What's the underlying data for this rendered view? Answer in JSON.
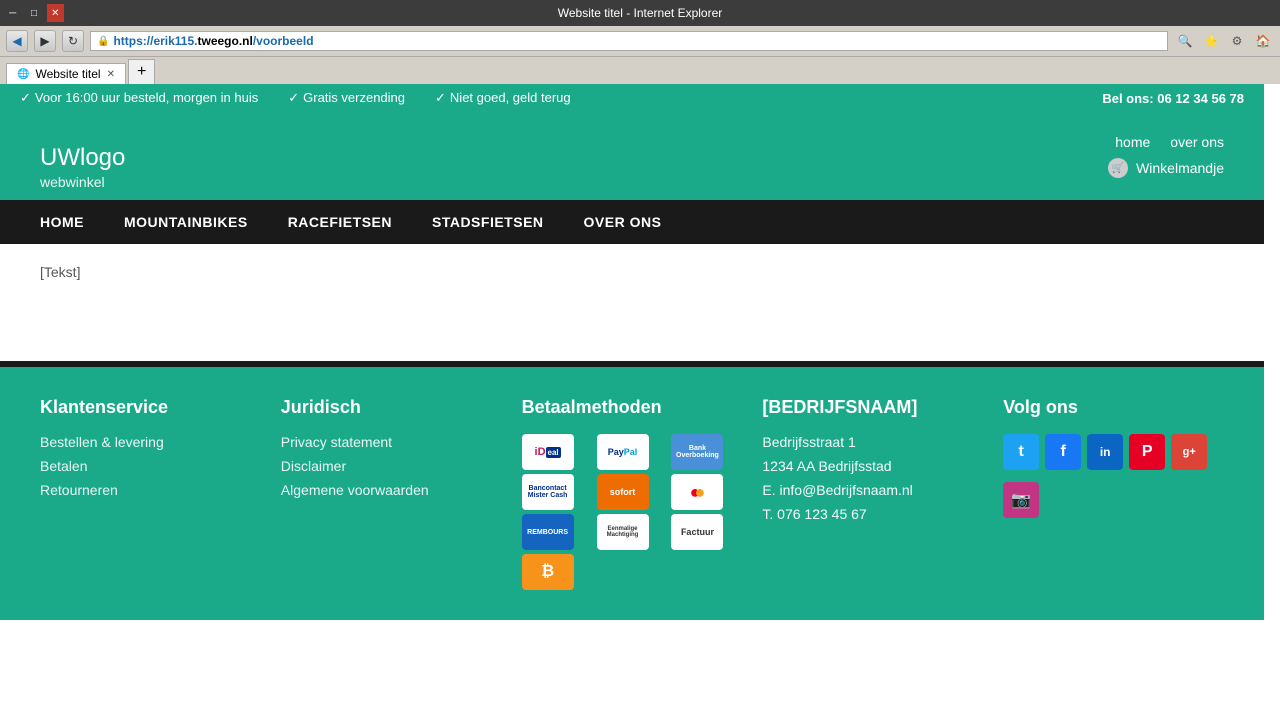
{
  "browser": {
    "title": "Website titel - Internet Explorer",
    "url_prefix": "https://erik115.",
    "url_domain": "tweego.nl",
    "url_path": "/voorbeeld",
    "tab_label": "Website titel"
  },
  "topbar": {
    "benefit1": "Voor 16:00 uur besteld, morgen in huis",
    "benefit2": "Gratis verzending",
    "benefit3": "Niet goed, geld terug",
    "phone_label": "Bel ons:",
    "phone": "06 12 34 56 78"
  },
  "header": {
    "logo_main": "UW",
    "logo_sub": "logo",
    "logo_tagline": "webwinkel",
    "nav_home": "home",
    "nav_about": "over ons",
    "cart_label": "Winkelmandje"
  },
  "mainnav": {
    "items": [
      {
        "label": "HOME"
      },
      {
        "label": "MOUNTAINBIKES"
      },
      {
        "label": "RACEFIETSEN"
      },
      {
        "label": "STADSFIETSEN"
      },
      {
        "label": "OVER ONS"
      }
    ]
  },
  "content": {
    "text": "[Tekst]"
  },
  "footer": {
    "col1_title": "Klantenservice",
    "col1_links": [
      {
        "label": "Bestellen & levering"
      },
      {
        "label": "Betalen"
      },
      {
        "label": "Retourneren"
      }
    ],
    "col2_title": "Juridisch",
    "col2_links": [
      {
        "label": "Privacy statement"
      },
      {
        "label": "Disclaimer"
      },
      {
        "label": "Algemene voorwaarden"
      }
    ],
    "col3_title": "Betaalmethoden",
    "col4_title": "[BEDRIJFSNAAM]",
    "company_street": "Bedrijfsstraat 1",
    "company_city": "1234 AA Bedrijfsstad",
    "company_email_label": "E.",
    "company_email": "info@Bedrijfsnaam.nl",
    "company_phone_label": "T.",
    "company_phone": "076 123 45 67",
    "col5_title": "Volg ons"
  },
  "payment_methods": [
    {
      "name": "iDEAL",
      "display": "iD"
    },
    {
      "name": "PayPal",
      "display": "PayPal"
    },
    {
      "name": "BankOverboeking",
      "display": "Bank Overboeking"
    },
    {
      "name": "Bancontact",
      "display": "Bancontact Mister Cash"
    },
    {
      "name": "Sofort",
      "display": "sofort"
    },
    {
      "name": "Mastercard",
      "display": "MC"
    },
    {
      "name": "Rembours",
      "display": "REMBOURS"
    },
    {
      "name": "EenmaligeMachtiging",
      "display": "Eenmalige Machtiging"
    },
    {
      "name": "Factuur",
      "display": "Factuur"
    },
    {
      "name": "Bitcoin",
      "display": "₿"
    }
  ],
  "social": [
    {
      "name": "Twitter",
      "letter": "t",
      "class": "si-twitter"
    },
    {
      "name": "Facebook",
      "letter": "f",
      "class": "si-facebook"
    },
    {
      "name": "LinkedIn",
      "letter": "in",
      "class": "si-linkedin"
    },
    {
      "name": "Pinterest",
      "letter": "P",
      "class": "si-pinterest"
    },
    {
      "name": "GooglePlus",
      "letter": "g+",
      "class": "si-gplus"
    },
    {
      "name": "Instagram",
      "letter": "📷",
      "class": "si-instagram"
    }
  ]
}
